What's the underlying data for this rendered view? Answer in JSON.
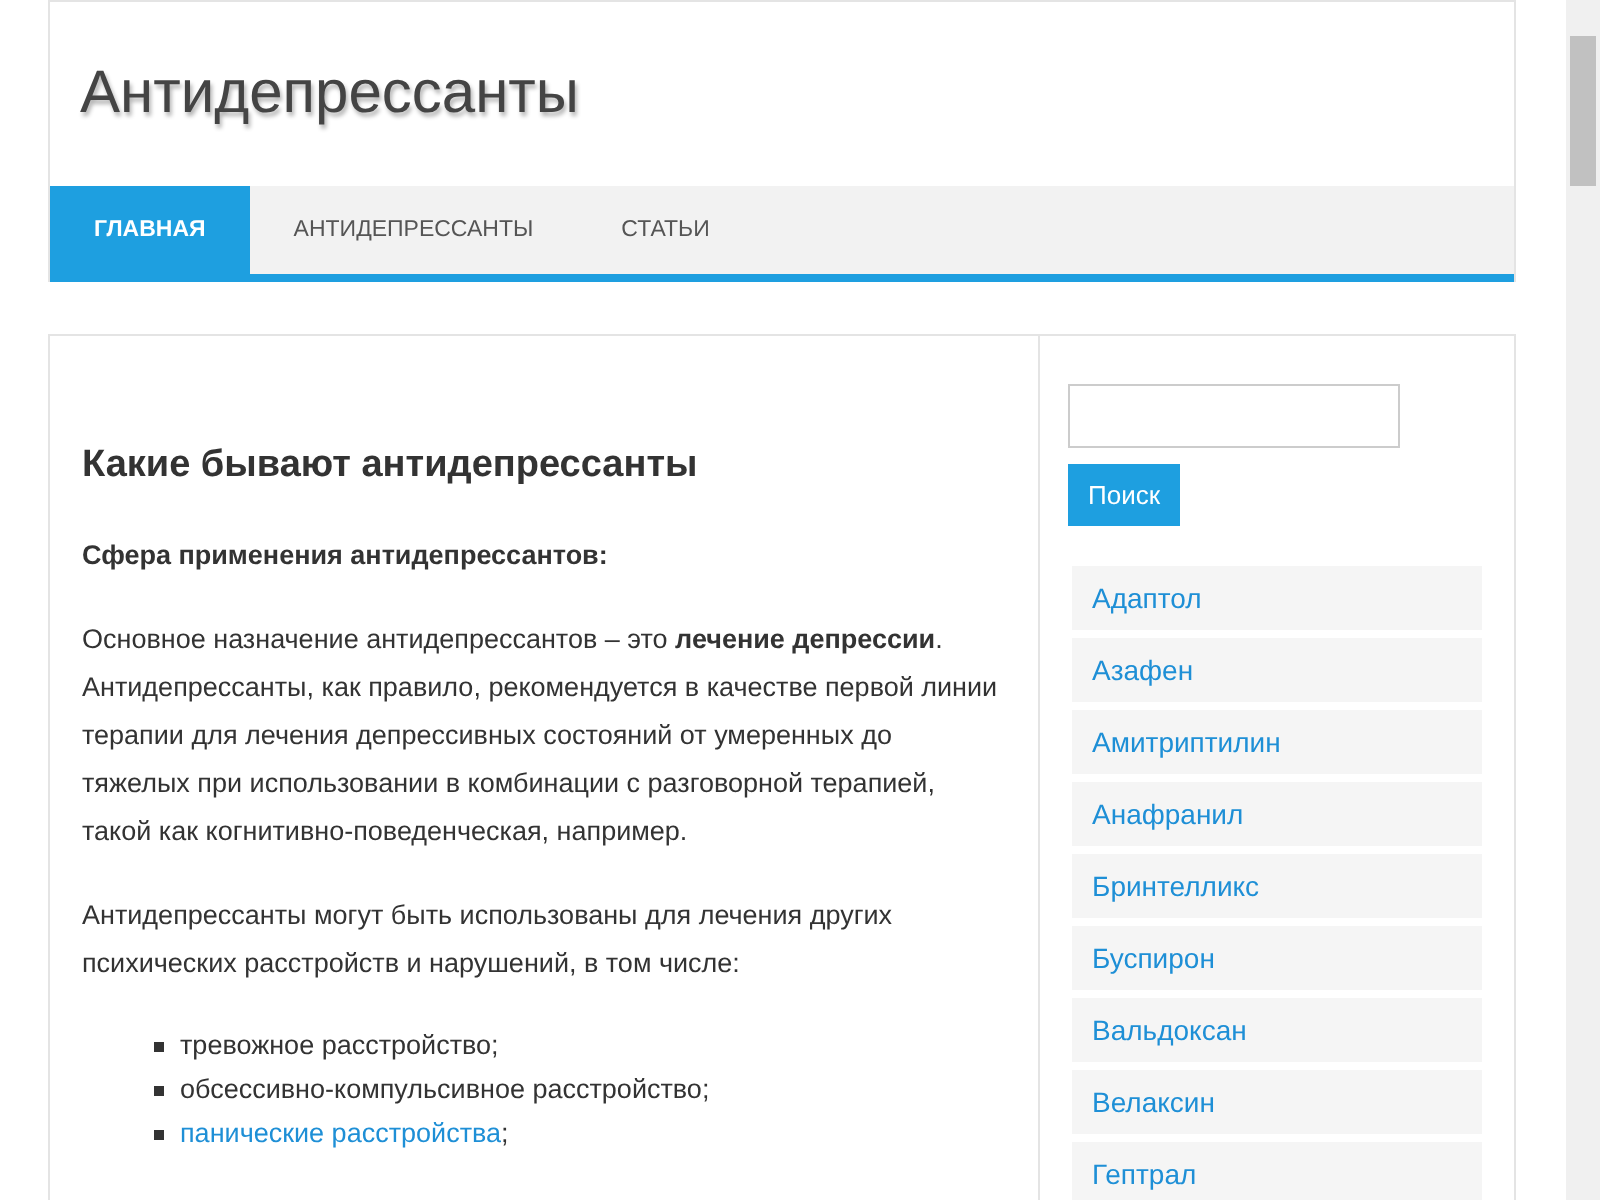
{
  "site": {
    "title": "Антидепрессанты"
  },
  "nav": [
    {
      "label": "ГЛАВНАЯ",
      "selected": true
    },
    {
      "label": "АНТИДЕПРЕССАНТЫ",
      "selected": false
    },
    {
      "label": "СТАТЬИ",
      "selected": false
    }
  ],
  "article": {
    "heading": "Какие бывают антидепрессанты",
    "subheading": "Сфера применения антидепрессантов:",
    "paragraphs": [
      "Основное назначение антидепрессантов – это **лечение депрессии**. Антидепрессанты, как правило, рекомендуется в качестве первой линии терапии для лечения депрессивных состояний от умеренных до тяжелых при использовании в комбинации с разговорной терапией, такой как когнитивно-поведенческая, например.",
      "Антидепрессанты могут быть использованы для лечения других психических расстройств и нарушений, в том числе:"
    ],
    "list": [
      {
        "kind": "plain",
        "text": "тревожное расстройство;"
      },
      {
        "kind": "plain",
        "text": "обсессивно-компульсивное расстройство;"
      },
      {
        "kind": "link",
        "text": "панические расстройства",
        "after": ";"
      }
    ]
  },
  "sidebar": {
    "search_button": "Поиск",
    "links": [
      "Адаптол",
      "Азафен",
      "Амитриптилин",
      "Анафранил",
      "Бринтелликс",
      "Буспирон",
      "Вальдоксан",
      "Велаксин",
      "Гептрал"
    ]
  }
}
